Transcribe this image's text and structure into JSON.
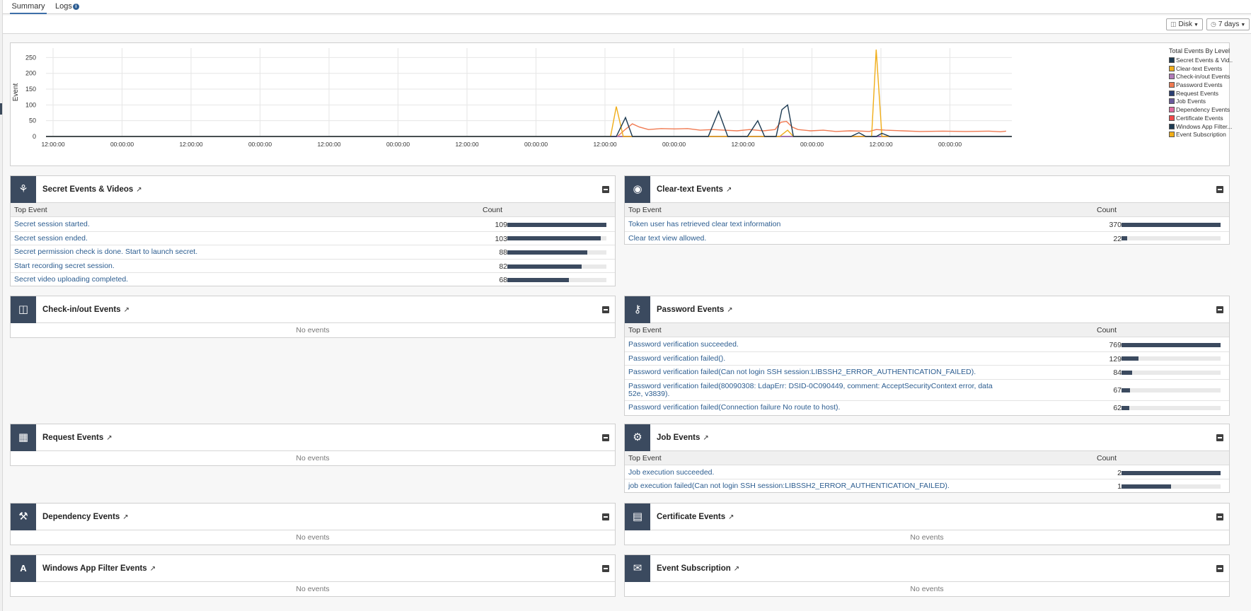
{
  "tabs": {
    "summary_label": "Summary",
    "logs_label": "Logs"
  },
  "toolbar": {
    "disk_label": "Disk",
    "range_label": "7 days"
  },
  "chart_data": {
    "type": "line",
    "title": "Total Events By Level",
    "xlabel": "",
    "ylabel": "Event",
    "ylim": [
      0,
      280
    ],
    "y_ticks": [
      0,
      50,
      100,
      150,
      200,
      250
    ],
    "x_tick_labels": [
      "12:00:00",
      "00:00:00",
      "12:00:00",
      "00:00:00",
      "12:00:00",
      "00:00:00",
      "12:00:00",
      "00:00:00",
      "12:00:00",
      "00:00:00",
      "12:00:00",
      "00:00:00",
      "12:00:00",
      "00:00:00"
    ],
    "x_range": [
      0,
      84
    ],
    "grid": true,
    "legend_placement": "right",
    "series": [
      {
        "name": "Secret Events & Vid...",
        "color": "#1c3a52",
        "points": [
          [
            0,
            0
          ],
          [
            49.6,
            0
          ],
          [
            50.4,
            60
          ],
          [
            51,
            0
          ],
          [
            57.6,
            0
          ],
          [
            58.5,
            80
          ],
          [
            59.3,
            0
          ],
          [
            61,
            0
          ],
          [
            61.9,
            50
          ],
          [
            62.5,
            0
          ],
          [
            63.5,
            0
          ],
          [
            64,
            85
          ],
          [
            64.5,
            100
          ],
          [
            65,
            0
          ],
          [
            70,
            0
          ],
          [
            70.7,
            12
          ],
          [
            71.3,
            0
          ],
          [
            72.2,
            0
          ],
          [
            72.7,
            10
          ],
          [
            73.4,
            0
          ],
          [
            84,
            0
          ]
        ]
      },
      {
        "name": "Clear-text Events",
        "color": "#f0ad18",
        "points": [
          [
            0,
            0
          ],
          [
            49.1,
            0
          ],
          [
            49.6,
            95
          ],
          [
            50.2,
            0
          ],
          [
            63.8,
            0
          ],
          [
            64.5,
            20
          ],
          [
            65,
            0
          ],
          [
            71.8,
            0
          ],
          [
            72.2,
            275
          ],
          [
            72.7,
            0
          ],
          [
            84,
            0
          ]
        ]
      },
      {
        "name": "Check-in/out Events",
        "color": "#b07ab8",
        "points": [
          [
            0,
            0
          ],
          [
            84,
            0
          ]
        ]
      },
      {
        "name": "Password Events",
        "color": "#f07a52",
        "points": [
          [
            0,
            0
          ],
          [
            49.7,
            0
          ],
          [
            50.3,
            20
          ],
          [
            51,
            40
          ],
          [
            51.6,
            30
          ],
          [
            52.4,
            22
          ],
          [
            53.5,
            25
          ],
          [
            54.7,
            24
          ],
          [
            55.8,
            25
          ],
          [
            56.9,
            20
          ],
          [
            58,
            22
          ],
          [
            59,
            20
          ],
          [
            60.1,
            18
          ],
          [
            61.2,
            22
          ],
          [
            62.4,
            18
          ],
          [
            63.4,
            22
          ],
          [
            63.9,
            45
          ],
          [
            64.4,
            48
          ],
          [
            64.9,
            30
          ],
          [
            65.4,
            22
          ],
          [
            66.5,
            18
          ],
          [
            67.6,
            20
          ],
          [
            68.7,
            16
          ],
          [
            69.9,
            18
          ],
          [
            71,
            17
          ],
          [
            71.6,
            16
          ],
          [
            72.2,
            22
          ],
          [
            73,
            20
          ],
          [
            74.5,
            18
          ],
          [
            76,
            16
          ],
          [
            78,
            17
          ],
          [
            80,
            16
          ],
          [
            82,
            17
          ],
          [
            83,
            15
          ],
          [
            83.5,
            17
          ]
        ]
      },
      {
        "name": "Request Events",
        "color": "#2a3e72",
        "points": [
          [
            0,
            0
          ],
          [
            84,
            0
          ]
        ]
      },
      {
        "name": "Job Events",
        "color": "#6a5a9c",
        "points": [
          [
            0,
            0
          ],
          [
            84,
            0
          ]
        ]
      },
      {
        "name": "Dependency Events",
        "color": "#e06aa0",
        "points": [
          [
            0,
            0
          ],
          [
            84,
            0
          ]
        ]
      },
      {
        "name": "Certificate Events",
        "color": "#f04a4a",
        "points": [
          [
            0,
            0
          ],
          [
            84,
            0
          ]
        ]
      },
      {
        "name": "Windows App Filter...",
        "color": "#1c3a52",
        "points": [
          [
            0,
            0
          ],
          [
            84,
            0
          ]
        ]
      },
      {
        "name": "Event Subscription",
        "color": "#f0ad18",
        "points": [
          [
            0,
            0
          ],
          [
            84,
            0
          ]
        ]
      }
    ]
  },
  "cards": {
    "secret": {
      "title": "Secret Events & Videos",
      "col_event": "Top Event",
      "col_count": "Count",
      "rows": [
        {
          "event": "Secret session started.",
          "count": "109",
          "fraction": 1.0
        },
        {
          "event": "Secret session ended.",
          "count": "103",
          "fraction": 0.945
        },
        {
          "event": "Secret permission check is done. Start to launch secret.",
          "count": "88",
          "fraction": 0.81
        },
        {
          "event": "Start recording secret session.",
          "count": "82",
          "fraction": 0.75
        },
        {
          "event": "Secret video uploading completed.",
          "count": "68",
          "fraction": 0.62
        }
      ]
    },
    "cleartext": {
      "title": "Clear-text Events",
      "col_event": "Top Event",
      "col_count": "Count",
      "rows": [
        {
          "event": "Token user has retrieved clear text information",
          "count": "370",
          "fraction": 1.0
        },
        {
          "event": "Clear text view allowed.",
          "count": "22",
          "fraction": 0.06
        }
      ]
    },
    "checkinout": {
      "title": "Check-in/out Events",
      "no_events": "No events"
    },
    "password": {
      "title": "Password Events",
      "col_event": "Top Event",
      "col_count": "Count",
      "rows": [
        {
          "event": "Password verification succeeded.",
          "count": "769",
          "fraction": 1.0
        },
        {
          "event": "Password verification failed().",
          "count": "129",
          "fraction": 0.17
        },
        {
          "event": "Password verification failed(Can not login SSH session:LIBSSH2_ERROR_AUTHENTICATION_FAILED).",
          "count": "84",
          "fraction": 0.11
        },
        {
          "event": "Password verification failed(80090308: LdapErr: DSID-0C090449, comment: AcceptSecurityContext error, data 52e, v3839).",
          "count": "67",
          "fraction": 0.087
        },
        {
          "event": "Password verification failed(Connection failure No route to host).",
          "count": "62",
          "fraction": 0.08
        }
      ]
    },
    "request": {
      "title": "Request Events",
      "no_events": "No events"
    },
    "job": {
      "title": "Job Events",
      "col_event": "Top Event",
      "col_count": "Count",
      "rows": [
        {
          "event": "Job execution succeeded.",
          "count": "2",
          "fraction": 1.0
        },
        {
          "event": "job execution failed(Can not login SSH session:LIBSSH2_ERROR_AUTHENTICATION_FAILED).",
          "count": "1",
          "fraction": 0.5
        }
      ]
    },
    "dependency": {
      "title": "Dependency Events",
      "no_events": "No events"
    },
    "certificate": {
      "title": "Certificate Events",
      "no_events": "No events"
    },
    "winapp": {
      "title": "Windows App Filter Events",
      "no_events": "No events"
    },
    "subscription": {
      "title": "Event Subscription",
      "no_events": "No events"
    }
  },
  "icons": {
    "secret": "user-lock-icon",
    "cleartext": "eye-icon",
    "checkinout": "door-icon",
    "password": "key-icon",
    "request": "calendar-icon",
    "job": "gears-icon",
    "dependency": "wrench-icon",
    "certificate": "certificate-icon",
    "winapp": "app-window-icon",
    "subscription": "subscription-icon"
  }
}
